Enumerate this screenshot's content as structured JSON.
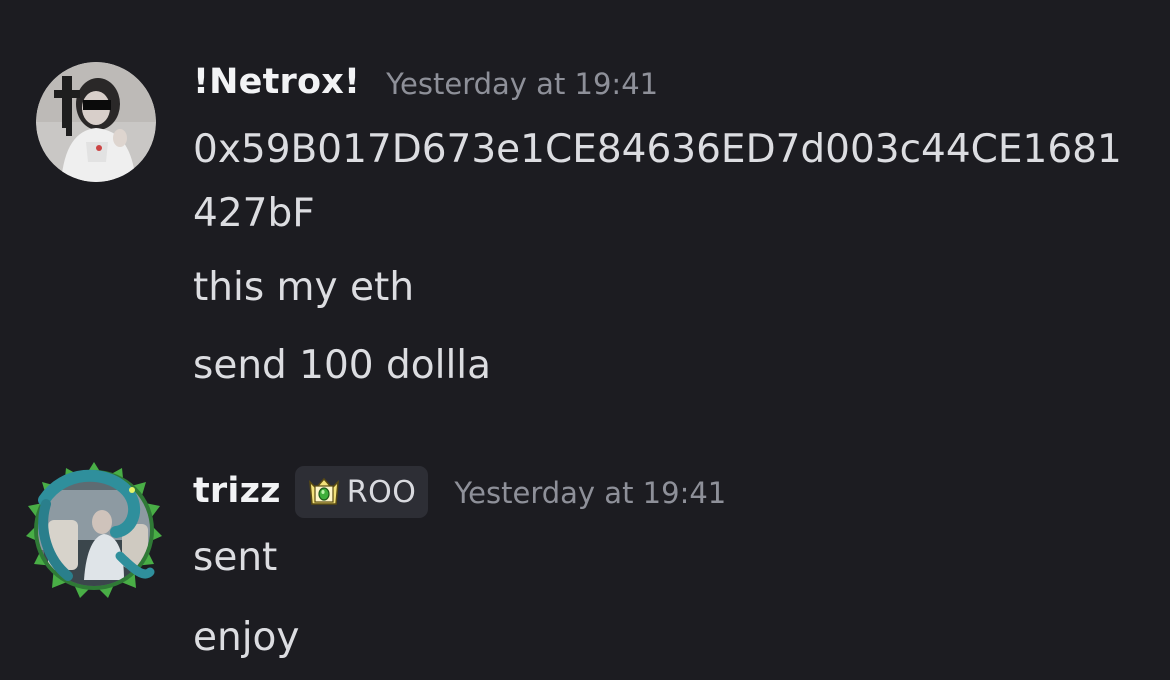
{
  "messages": [
    {
      "username": "!Netrox!",
      "timestamp": "Yesterday at 19:41",
      "avatar_icon": "avatar-netrox",
      "lines": [
        "0x59B017D673e1CE84636ED7d003c44CE1681",
        "427bF",
        "this my eth",
        "send 100 dollla"
      ]
    },
    {
      "username": "trizz",
      "role_tag": "ROO",
      "role_icon": "crown-gem-icon",
      "timestamp": "Yesterday at 19:41",
      "avatar_icon": "avatar-trizz",
      "lines": [
        "sent",
        "enjoy"
      ]
    }
  ],
  "colors": {
    "background": "#1c1c21",
    "username": "#f2f3f5",
    "text": "#dcdde1",
    "timestamp": "#8e9099",
    "role_tag_bg": "#2d2e35",
    "avatar_frame": "#5ad65a"
  }
}
